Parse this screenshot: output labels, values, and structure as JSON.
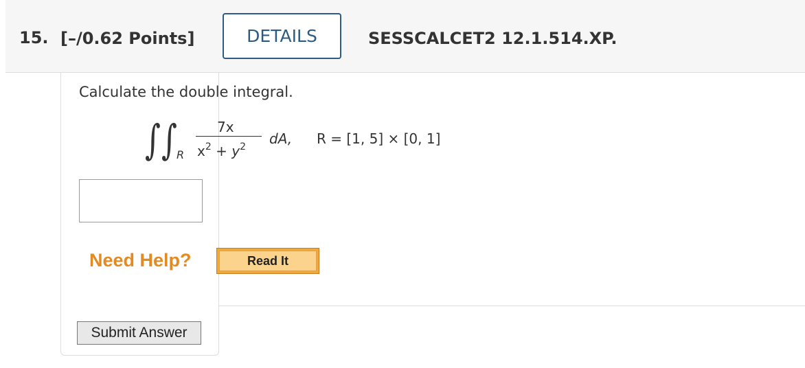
{
  "header": {
    "question_number": "15.",
    "points": "[–/0.62 Points]",
    "details_label": "DETAILS",
    "source_id": "SESSCALCET2 12.1.514.XP."
  },
  "question": {
    "prompt": "Calculate the double integral.",
    "integral": {
      "integral_sign": "∫",
      "subscript": "R",
      "numerator": "7x",
      "denominator_x": "x",
      "denominator_exp_x": "2",
      "denominator_plus": " + ",
      "denominator_y": "y",
      "denominator_exp_y": "2",
      "differential": "dA,",
      "region": "R = [1, 5] × [0, 1]"
    },
    "answer_value": ""
  },
  "help": {
    "need_help_label": "Need Help?",
    "read_it_label": "Read It"
  },
  "actions": {
    "submit_label": "Submit Answer"
  }
}
